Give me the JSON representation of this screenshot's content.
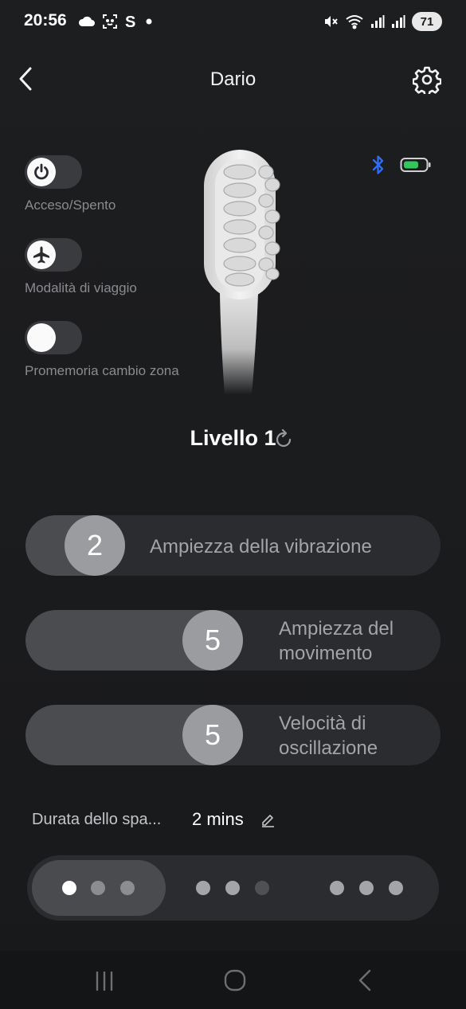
{
  "status_bar": {
    "time": "20:56",
    "left_icons": [
      "cloud-icon",
      "face-scan-icon",
      "s-icon",
      "dot-icon"
    ],
    "right_icons": [
      "mute-icon",
      "wifi-icon",
      "signal-icon",
      "signal-icon"
    ],
    "battery": "71"
  },
  "header": {
    "title": "Dario"
  },
  "toggles": [
    {
      "label": "Acceso/Spento",
      "icon": "power-icon",
      "on": false
    },
    {
      "label": "Modalità di viaggio",
      "icon": "airplane-icon",
      "on": false
    },
    {
      "label": "Promemoria cambio zona",
      "icon": "",
      "on": false
    }
  ],
  "device": {
    "bluetooth_icon": "bluetooth-icon",
    "battery_icon": "battery-icon",
    "battery_color": "#33c75a"
  },
  "level": {
    "label": "Livello 1"
  },
  "sliders": [
    {
      "value": "2",
      "label": "Ampiezza della vibrazione",
      "level": 2
    },
    {
      "value": "5",
      "label": "Ampiezza del movimento",
      "level": 5
    },
    {
      "value": "5",
      "label": "Velocità di oscillazione",
      "level": 5
    }
  ],
  "duration": {
    "label": "Durata dello spa...",
    "value": "2 mins"
  },
  "modes": {
    "selected_index": 0
  },
  "colors": {
    "accent_bluetooth": "#2f6df6",
    "slider_thumb": "#9b9c9f"
  }
}
